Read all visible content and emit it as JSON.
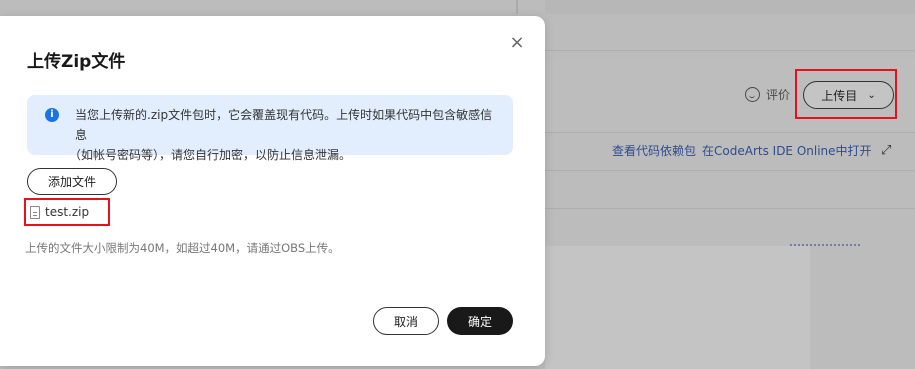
{
  "background": {
    "rating_label": "评价",
    "upload_button_label": "上传目",
    "links": [
      "查看代码依赖包",
      "在CodeArts IDE Online中打开"
    ]
  },
  "modal": {
    "title": "上传Zip文件",
    "info_line1": "当您上传新的.zip文件包时，它会覆盖现有代码。上传时如果代码中包含敏感信息",
    "info_line2": "（如帐号密码等），请您自行加密，以防止信息泄漏。",
    "add_file_label": "添加文件",
    "file_name": "test.zip",
    "hint": "上传的文件大小限制为40M，如超过40M，请通过OBS上传。",
    "cancel_label": "取消",
    "confirm_label": "确定"
  },
  "colors": {
    "highlight_red": "#e5121b",
    "info_bg": "#e2eefd",
    "primary_dark": "#191919"
  }
}
